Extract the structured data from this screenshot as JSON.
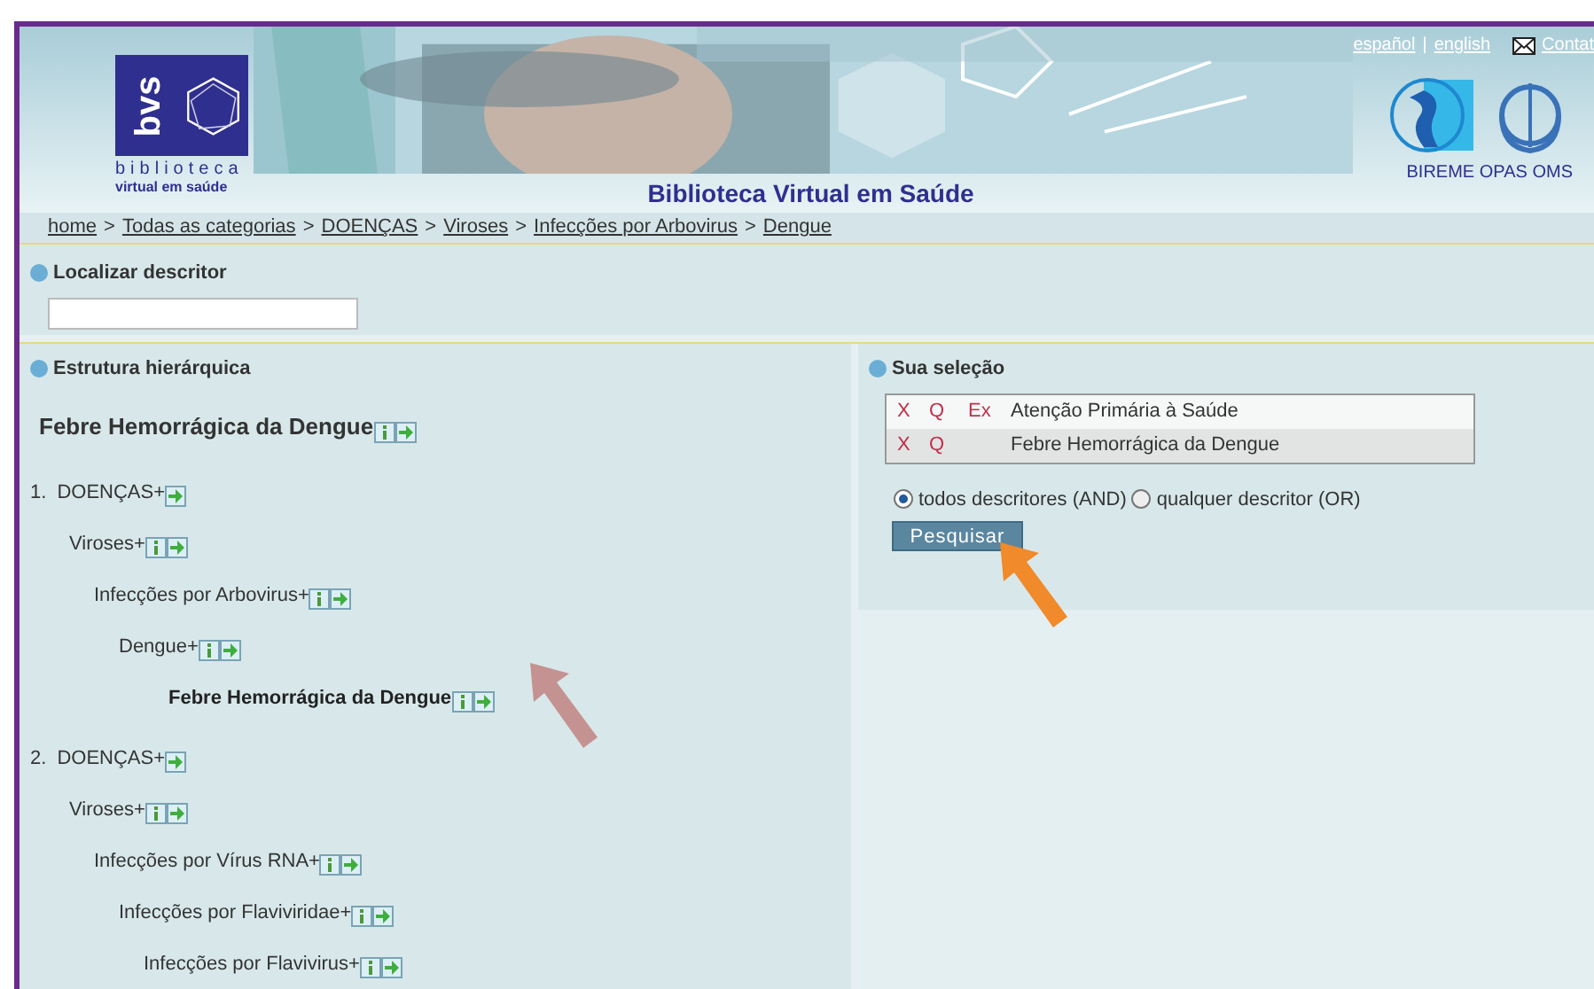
{
  "header": {
    "logo_mark": "bvs",
    "logo_line1": "biblioteca",
    "logo_line2": "virtual em saúde",
    "title": "Biblioteca Virtual em Saúde",
    "languages": [
      {
        "label": "español"
      },
      {
        "separator": "|",
        "label": "english"
      }
    ],
    "contact": "Contat",
    "orgs": "BIREME OPAS OMS"
  },
  "breadcrumb": [
    {
      "label": "home"
    },
    {
      "separator": ">",
      "label": "Todas as categorias"
    },
    {
      "separator": ">",
      "label": "DOENÇAS"
    },
    {
      "separator": ">",
      "label": "Viroses"
    },
    {
      "separator": ">",
      "label": "Infecções por Arbovirus"
    },
    {
      "separator": ">",
      "label": "Dengue"
    }
  ],
  "search": {
    "title": "Localizar descritor"
  },
  "hierarchy": {
    "title": "Estrutura hierárquica",
    "term": "Febre Hemorrágica da Dengue",
    "trees": [
      {
        "number": "1.",
        "label": "DOENÇAS+",
        "info": false,
        "current": false,
        "children": [
          {
            "label": "Viroses+",
            "info": true,
            "current": false,
            "children": [
              {
                "label": "Infecções por Arbovirus+",
                "info": true,
                "current": false,
                "children": [
                  {
                    "label": "Dengue+",
                    "info": true,
                    "current": false,
                    "children": [
                      {
                        "label": "Febre Hemorrágica da Dengue",
                        "info": true,
                        "current": true
                      }
                    ]
                  }
                ]
              }
            ]
          }
        ]
      },
      {
        "number": "2.",
        "label": "DOENÇAS+",
        "info": false,
        "current": false,
        "children": [
          {
            "label": "Viroses+",
            "info": true,
            "current": false,
            "children": [
              {
                "label": "Infecções por Vírus RNA+",
                "info": true,
                "current": false,
                "children": [
                  {
                    "label": "Infecções por Flaviviridae+",
                    "info": true,
                    "current": false,
                    "children": [
                      {
                        "label": "Infecções por Flavivirus+",
                        "info": true,
                        "current": false
                      }
                    ]
                  }
                ]
              }
            ]
          }
        ]
      }
    ]
  },
  "selection": {
    "title": "Sua seleção",
    "rows": [
      {
        "remove": "X",
        "query": "Q",
        "explode": "Ex",
        "label": "Atenção Primária à Saúde"
      },
      {
        "remove": "X",
        "query": "Q",
        "label": "Febre Hemorrágica da Dengue"
      }
    ],
    "options": [
      {
        "label": "todos descritores (AND)",
        "selected": true
      },
      {
        "label": "qualquer descritor (OR)",
        "selected": false
      }
    ],
    "button": "Pesquisar"
  }
}
